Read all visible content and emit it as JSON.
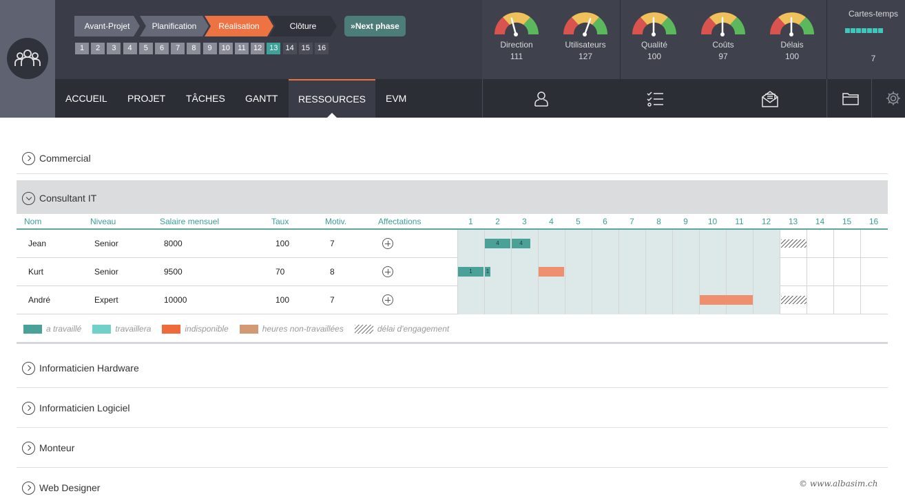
{
  "phases": [
    "Avant-Projet",
    "Planification",
    "Réalisation",
    "Clôture"
  ],
  "next_phase_label": "Next phase",
  "weeks": [
    "1",
    "2",
    "3",
    "4",
    "5",
    "6",
    "7",
    "8",
    "9",
    "10",
    "11",
    "12",
    "13",
    "14",
    "15",
    "16"
  ],
  "current_week": "13",
  "gauges": [
    {
      "label": "Direction",
      "value": "111"
    },
    {
      "label": "Utilisateurs",
      "value": "127"
    },
    {
      "label": "Qualité",
      "value": "100"
    },
    {
      "label": "Coûts",
      "value": "97"
    },
    {
      "label": "Délais",
      "value": "100"
    }
  ],
  "cartes_temps": {
    "title": "Cartes-temps",
    "value": "7",
    "dots": 7
  },
  "nav": [
    "ACCUEIL",
    "PROJET",
    "TÂCHES",
    "GANTT",
    "RESSOURCES",
    "EVM"
  ],
  "nav_active": "RESSOURCES",
  "toolbar_icons": [
    "user-icon",
    "checklist-icon",
    "mail-icon",
    "folder-icon",
    "gear-icon"
  ],
  "sections": {
    "commercial": "Commercial",
    "consultant": "Consultant IT",
    "hardware": "Informaticien Hardware",
    "logiciel": "Informaticien Logiciel",
    "monteur": "Monteur",
    "webdesigner": "Web Designer"
  },
  "table": {
    "headers": {
      "nom": "Nom",
      "niveau": "Niveau",
      "salaire": "Salaire mensuel",
      "taux": "Taux",
      "motiv": "Motiv.",
      "affectations": "Affectations"
    },
    "rows": [
      {
        "nom": "Jean",
        "niveau": "Senior",
        "salaire": "8000",
        "taux": "100",
        "motiv": "7",
        "bars": [
          {
            "week": 2,
            "label": "4"
          },
          {
            "week": 3,
            "label": "4"
          }
        ]
      },
      {
        "nom": "Kurt",
        "niveau": "Senior",
        "salaire": "9500",
        "taux": "70",
        "motiv": "8",
        "bars": [
          {
            "week": 1,
            "label": "1"
          },
          {
            "week": 2,
            "label": "1"
          }
        ]
      },
      {
        "nom": "André",
        "niveau": "Expert",
        "salaire": "10000",
        "taux": "100",
        "motiv": "7",
        "bars": []
      }
    ]
  },
  "legend": [
    {
      "label": "a travaillé",
      "color": "#4aa198"
    },
    {
      "label": "travaillera",
      "color": "#6fd1c7"
    },
    {
      "label": "indisponible",
      "color": "#ee6a3a"
    },
    {
      "label": "heures non-travaillées",
      "color": "#d29a73"
    },
    {
      "label": "délai d'engagement",
      "color": "hatch"
    }
  ],
  "copyright": "© www.albasim.ch"
}
